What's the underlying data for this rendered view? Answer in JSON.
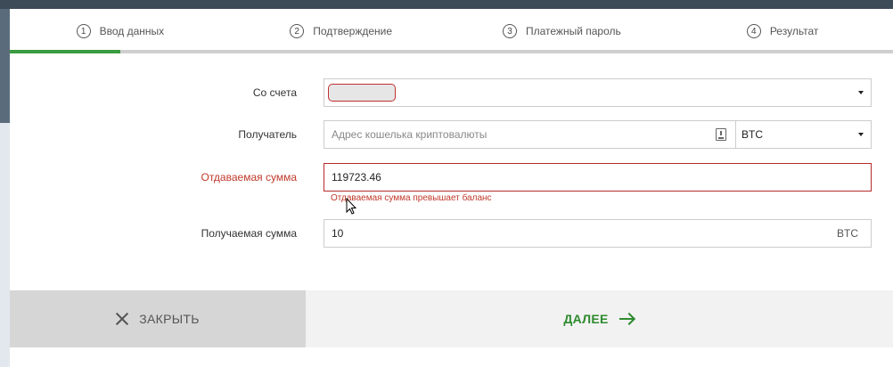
{
  "steps": [
    {
      "num": "1",
      "label": "Ввод данных"
    },
    {
      "num": "2",
      "label": "Подтверждение"
    },
    {
      "num": "3",
      "label": "Платежный пароль"
    },
    {
      "num": "4",
      "label": "Результат"
    }
  ],
  "active_step": 1,
  "form": {
    "from_account": {
      "label": "Со счета"
    },
    "recipient": {
      "label": "Получатель",
      "placeholder": "Адрес кошелька криптовалюты",
      "currency": "BTC"
    },
    "send_amount": {
      "label": "Отдаваемая сумма",
      "value": "119723.46",
      "error": "Отдаваемая сумма превышает баланс"
    },
    "receive_amount": {
      "label": "Получаемая сумма",
      "value": "10",
      "currency": "BTC"
    }
  },
  "footer": {
    "close_label": "ЗАКРЫТЬ",
    "next_label": "ДАЛЕЕ"
  },
  "colors": {
    "accent_green": "#2e8b2e",
    "error_red": "#c0392b",
    "progress": "#3b9b3f"
  }
}
